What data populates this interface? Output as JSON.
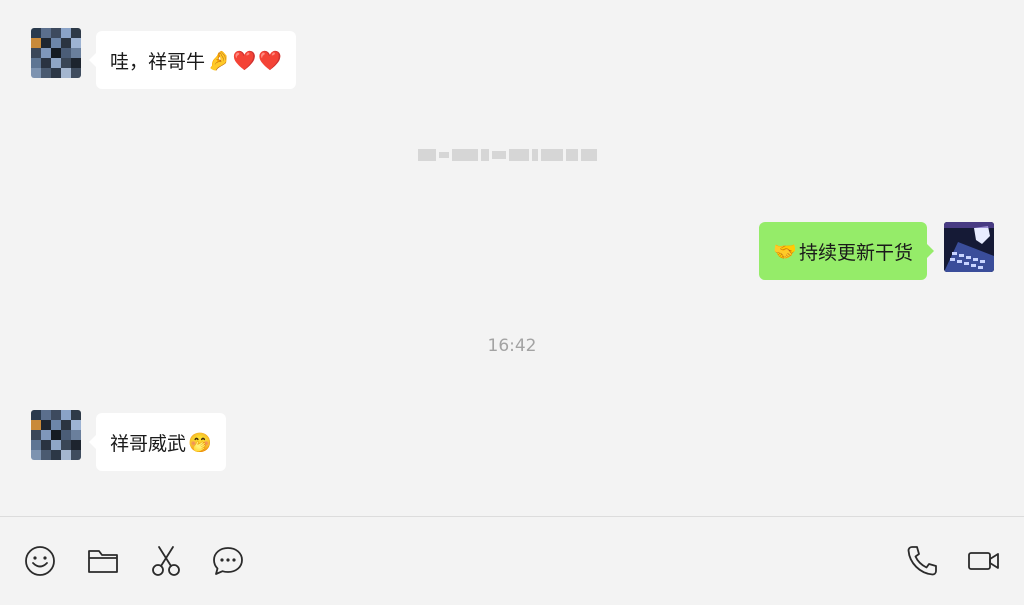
{
  "messages": [
    {
      "direction": "in",
      "text": "哇，祥哥牛",
      "emojis": [
        "🤌",
        "❤️",
        "❤️"
      ]
    },
    {
      "direction": "out",
      "text": "持续更新干货",
      "emojis": [
        "🤝"
      ]
    },
    {
      "direction": "in",
      "text": "祥哥威武",
      "emojis": [
        "🤭"
      ]
    }
  ],
  "timestamps": {
    "second": "16:42"
  },
  "toolbar": {
    "left_icons": [
      "emoji-icon",
      "folder-icon",
      "scissors-icon",
      "chat-history-icon"
    ],
    "right_icons": [
      "phone-icon",
      "video-call-icon"
    ]
  },
  "colors": {
    "background": "#f3f3f3",
    "incoming_bubble": "#ffffff",
    "outgoing_bubble": "#95ec69",
    "icon_stroke": "#2b2b2b",
    "timestamp": "#a3a3a3"
  }
}
